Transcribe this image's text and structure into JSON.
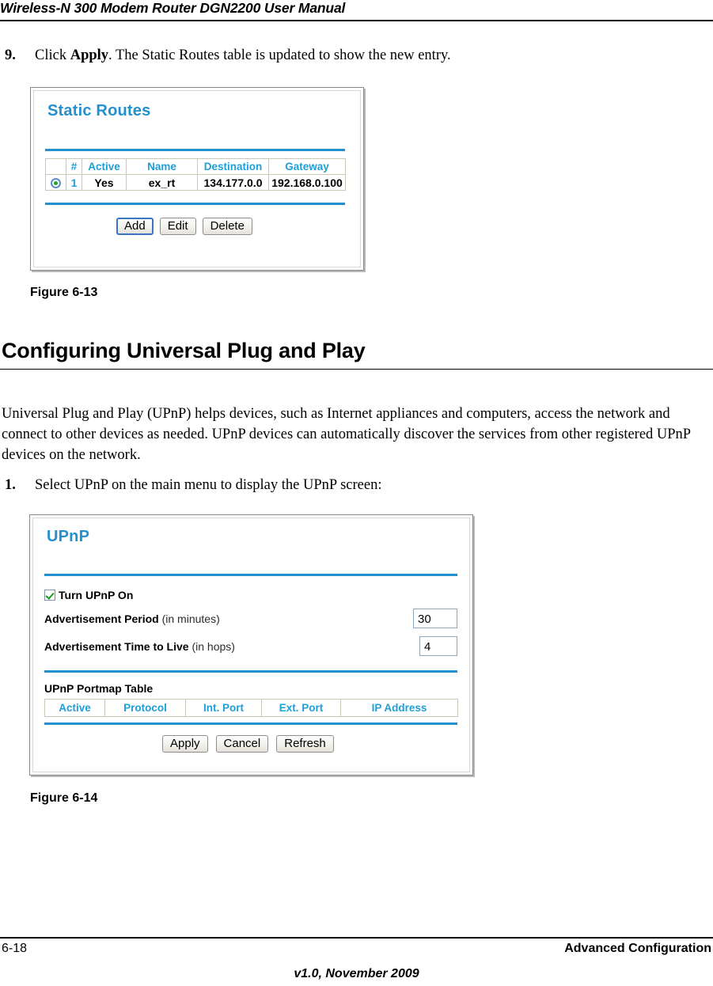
{
  "header": {
    "title": "Wireless-N 300 Modem Router DGN2200 User Manual"
  },
  "steps": [
    {
      "number": "9.",
      "text_before": "Click ",
      "text_bold": "Apply",
      "text_after": ". The Static Routes table is updated to show the new entry."
    },
    {
      "number": "1.",
      "text": "Select UPnP on the main menu to display the UPnP screen:"
    }
  ],
  "static_routes_panel": {
    "title": "Static Routes",
    "table": {
      "headers": [
        "",
        "#",
        "Active",
        "Name",
        "Destination",
        "Gateway"
      ],
      "rows": [
        {
          "selected": true,
          "index": "1",
          "active": "Yes",
          "name": "ex_rt",
          "destination": "134.177.0.0",
          "gateway": "192.168.0.100"
        }
      ]
    },
    "buttons": [
      {
        "label": "Add",
        "focused": true
      },
      {
        "label": "Edit",
        "focused": false
      },
      {
        "label": "Delete",
        "focused": false
      }
    ]
  },
  "figure_13_caption": "Figure 6-13",
  "section": {
    "heading": "Configuring Universal Plug and Play",
    "paragraph": "Universal Plug and Play (UPnP) helps devices, such as Internet appliances and computers, access the network and connect to other devices as needed. UPnP devices can automatically discover the services from other registered UPnP devices on the network."
  },
  "upnp_panel": {
    "title": "UPnP",
    "checkbox": {
      "label": "Turn UPnP On",
      "checked": true
    },
    "fields": [
      {
        "label_strong": "Advertisement Period",
        "label_light": " (in minutes)",
        "value": "30"
      },
      {
        "label_strong": "Advertisement Time to Live",
        "label_light": " (in hops)",
        "value": "4"
      }
    ],
    "portmap": {
      "title": "UPnP Portmap Table",
      "headers": [
        "Active",
        "Protocol",
        "Int. Port",
        "Ext. Port",
        "IP Address"
      ],
      "rows": []
    },
    "buttons": [
      {
        "label": "Apply"
      },
      {
        "label": "Cancel"
      },
      {
        "label": "Refresh"
      }
    ]
  },
  "figure_14_caption": "Figure 6-14",
  "footer": {
    "page_number": "6-18",
    "chapter": "Advanced Configuration",
    "version": "v1.0, November 2009"
  },
  "colors": {
    "panel_title_blue": "#2390cf",
    "rule_blue": "#2390cf",
    "table_header_blue": "#1f9fd8",
    "focus_blue": "#3a76c4",
    "check_green": "#1a9a1a"
  }
}
